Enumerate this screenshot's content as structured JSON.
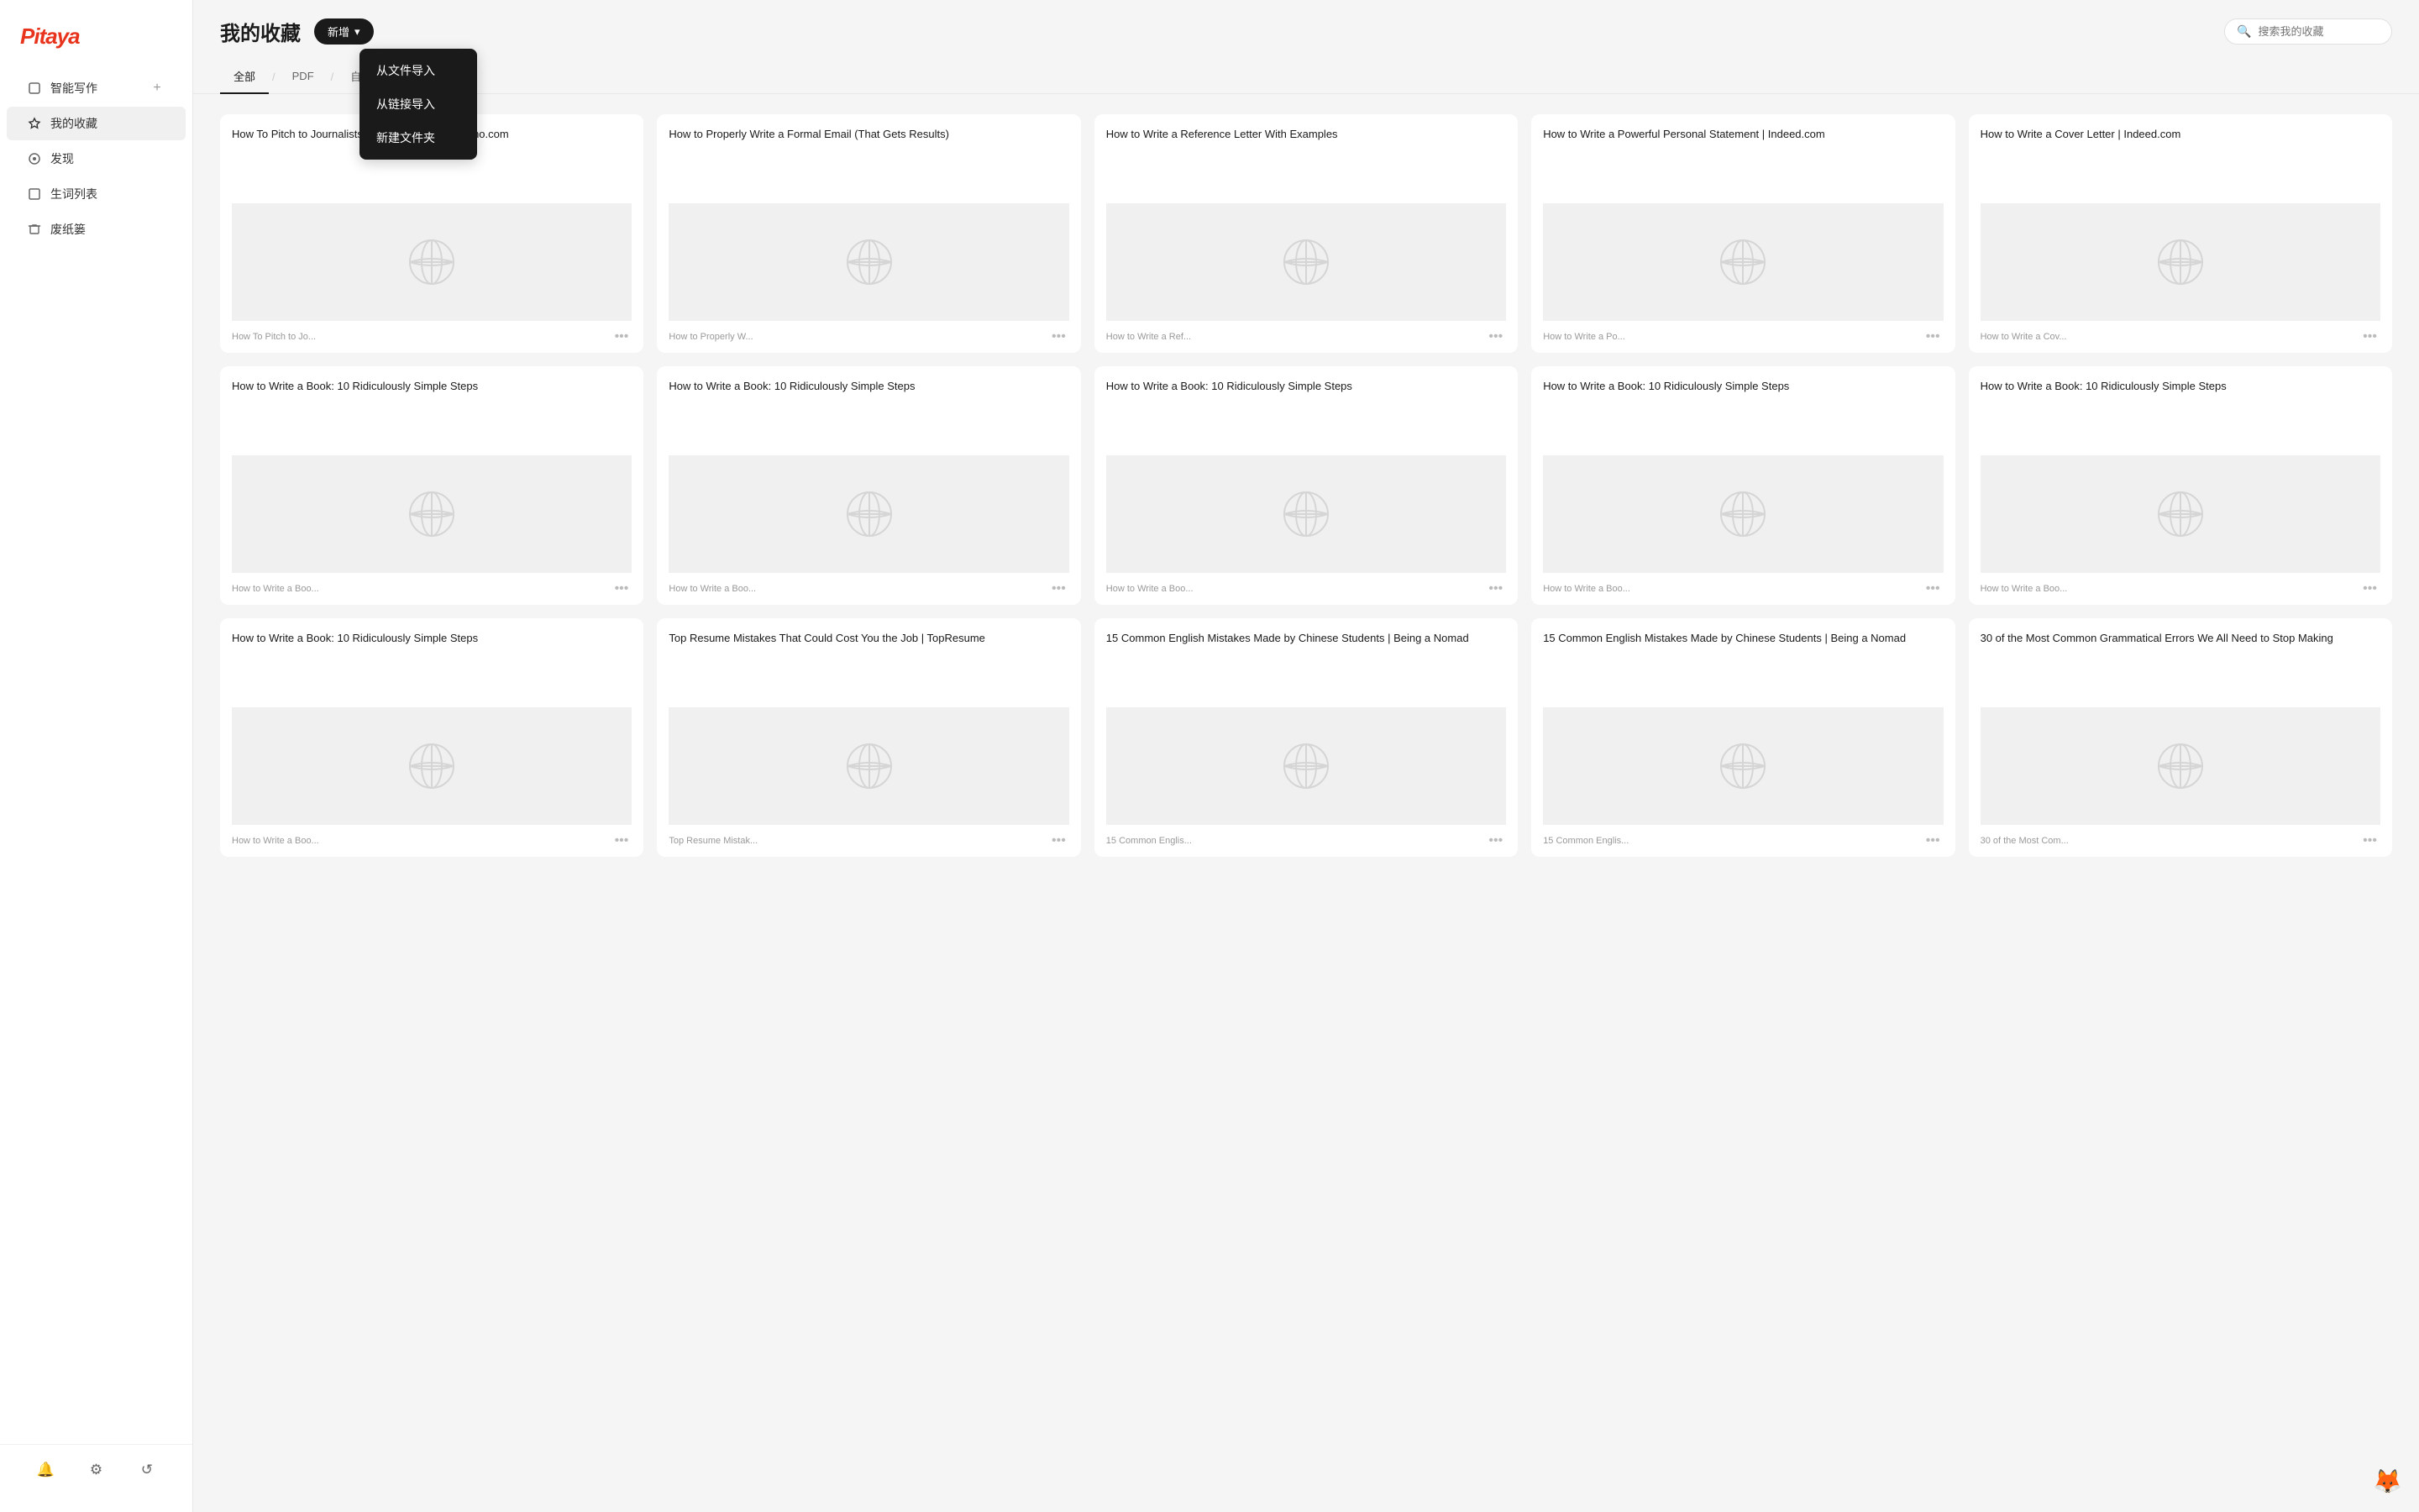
{
  "app": {
    "logo": "Pitaya"
  },
  "sidebar": {
    "items": [
      {
        "id": "smart-write",
        "label": "智能写作",
        "icon": "✎"
      },
      {
        "id": "favorites",
        "label": "我的收藏",
        "icon": "☆"
      },
      {
        "id": "discover",
        "label": "发现",
        "icon": "✦"
      },
      {
        "id": "word-list",
        "label": "生词列表",
        "icon": "☐"
      },
      {
        "id": "trash",
        "label": "废纸篓",
        "icon": "🗑"
      }
    ],
    "bottom_icons": [
      {
        "id": "bell",
        "icon": "🔔"
      },
      {
        "id": "settings",
        "icon": "⚙"
      },
      {
        "id": "refresh",
        "icon": "↺"
      }
    ]
  },
  "header": {
    "title": "我的收藏",
    "new_btn_label": "新增",
    "search_placeholder": "搜索我的收藏"
  },
  "tabs": [
    {
      "id": "all",
      "label": "全部",
      "active": true
    },
    {
      "id": "pdf",
      "label": "PDF"
    },
    {
      "id": "discover",
      "label": "自发现"
    }
  ],
  "dropdown": {
    "items": [
      {
        "id": "import-file",
        "label": "从文件导入"
      },
      {
        "id": "import-link",
        "label": "从链接导入"
      },
      {
        "id": "new-folder",
        "label": "新建文件夹"
      }
    ]
  },
  "cards": [
    {
      "id": 1,
      "title": "How To Pitch to Journalists: Expert Tips | BuzzSumo.com",
      "footer": "How To Pitch to Jo..."
    },
    {
      "id": 2,
      "title": "How to Properly Write a Formal Email (That Gets Results)",
      "footer": "How to Properly W..."
    },
    {
      "id": 3,
      "title": "How to Write a Reference Letter With Examples",
      "footer": "How to Write a Ref..."
    },
    {
      "id": 4,
      "title": "How to Write a Powerful Personal Statement | Indeed.com",
      "footer": "How to Write a Po..."
    },
    {
      "id": 5,
      "title": "How to Write a Cover Letter | Indeed.com",
      "footer": "How to Write a Cov..."
    },
    {
      "id": 6,
      "title": "How to Write a Book: 10 Ridiculously Simple Steps",
      "footer": "How to Write a Boo..."
    },
    {
      "id": 7,
      "title": "How to Write a Book: 10 Ridiculously Simple Steps",
      "footer": "How to Write a Boo..."
    },
    {
      "id": 8,
      "title": "How to Write a Book: 10 Ridiculously Simple Steps",
      "footer": "How to Write a Boo..."
    },
    {
      "id": 9,
      "title": "How to Write a Book: 10 Ridiculously Simple Steps",
      "footer": "How to Write a Boo..."
    },
    {
      "id": 10,
      "title": "How to Write a Book: 10 Ridiculously Simple Steps",
      "footer": "How to Write a Boo..."
    },
    {
      "id": 11,
      "title": "How to Write a Book: 10 Ridiculously Simple Steps",
      "footer": "How to Write a Boo..."
    },
    {
      "id": 12,
      "title": "Top Resume Mistakes That Could Cost You the Job | TopResume",
      "footer": "Top Resume Mistak..."
    },
    {
      "id": 13,
      "title": "15 Common English Mistakes Made by Chinese Students | Being a Nomad",
      "footer": "15 Common Englis..."
    },
    {
      "id": 14,
      "title": "15 Common English Mistakes Made by Chinese Students | Being a Nomad",
      "footer": "15 Common Englis..."
    },
    {
      "id": 15,
      "title": "30 of the Most Common Grammatical Errors We All Need to Stop Making",
      "footer": "30 of the Most Com..."
    }
  ]
}
